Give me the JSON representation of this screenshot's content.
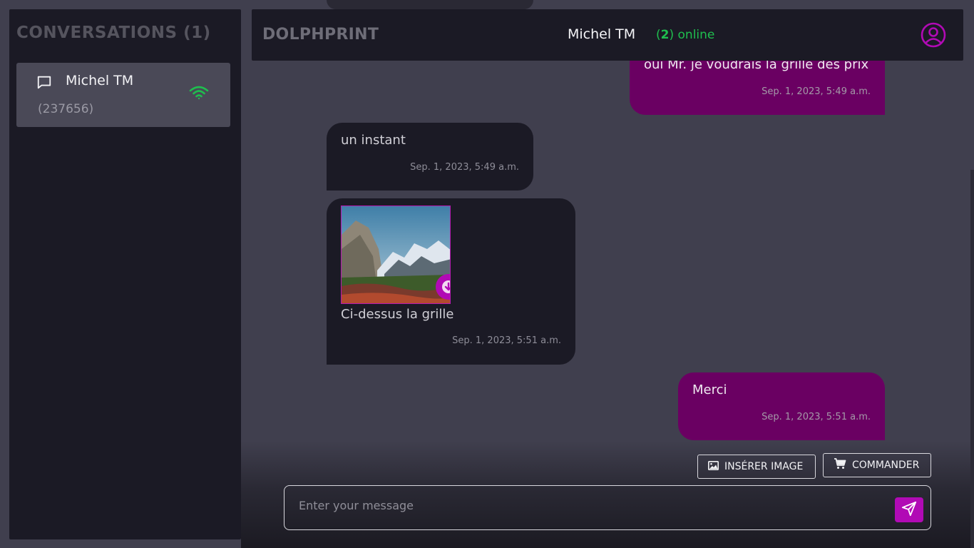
{
  "sidebar": {
    "title": "CONVERSATIONS (1)",
    "conversations": [
      {
        "name": "Michel TM",
        "id": "(237656)",
        "status_icon": "wifi-icon",
        "status_color": "#1fbe4e"
      }
    ]
  },
  "header": {
    "brand": "DOLPHPRINT",
    "user": "Michel TM",
    "online_count": "2",
    "online_label": "online",
    "profile_icon": "user-circle-icon",
    "accent": "#b10ab5"
  },
  "messages": [
    {
      "direction": "out",
      "text": "oui Mr. je voudrais la grille des prix",
      "time": "Sep. 1, 2023, 5:49 a.m."
    },
    {
      "direction": "in",
      "text": "un instant",
      "time": "Sep. 1, 2023, 5:49 a.m."
    },
    {
      "direction": "in",
      "image": "mountain-valley-photo",
      "text": "Ci-dessus la grille",
      "time": "Sep. 1, 2023, 5:51 a.m."
    },
    {
      "direction": "out",
      "text": "Merci",
      "time": "Sep. 1, 2023, 5:51 a.m."
    }
  ],
  "composer": {
    "insert_image_label": "INSÉRER IMAGE",
    "order_label": "COMMANDER",
    "placeholder": "Enter your message"
  },
  "colors": {
    "outgoing_bubble": "#6a0062",
    "incoming_bubble": "#1b1a25",
    "online_green": "#1fbe4e"
  }
}
